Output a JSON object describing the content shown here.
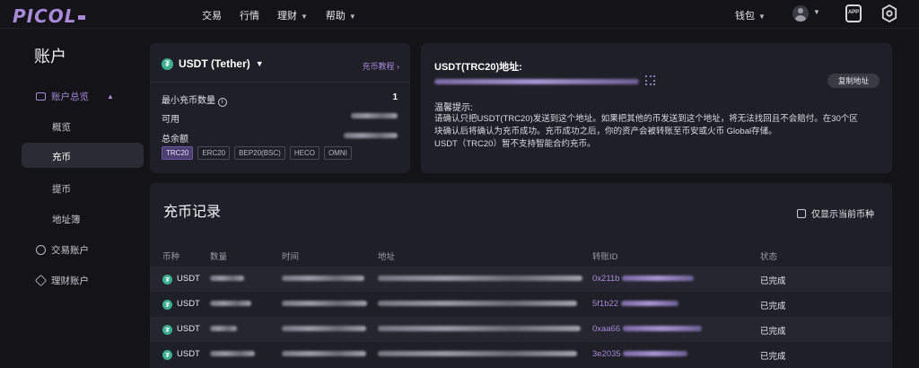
{
  "brand": {
    "logo": "PICOL"
  },
  "nav": {
    "items": [
      "交易",
      "行情",
      "理财",
      "帮助"
    ]
  },
  "topbar": {
    "wallet": "钱包",
    "app_icon": "APP"
  },
  "sidebar": {
    "title": "账户",
    "overview_group": "账户总览",
    "sub_items": [
      "概览",
      "充币",
      "提币",
      "地址簿"
    ],
    "trade_account": "交易账户",
    "finance_account": "理财账户"
  },
  "deposit": {
    "coin": "USDT (Tether)",
    "tutorial": "充币教程",
    "min_label": "最小充币数量",
    "min_value": "1",
    "available_label": "可用",
    "total_label": "总余额",
    "networks": [
      "TRC20",
      "ERC20",
      "BEP20(BSC)",
      "HECO",
      "OMNI"
    ],
    "active_network": "TRC20"
  },
  "address": {
    "title": "USDT(TRC20)地址:",
    "copy": "复制地址",
    "notice_title": "温馨提示:",
    "notice_lines": [
      "请确认只把USDT(TRC20)发送到这个地址。如果把其他的币发送到这个地址，将无法找回且不会赔付。在30个区",
      "块确认后将确认为充币成功。充币成功之后，你的资产会被转账至币安或火币 Global存储。",
      "USDT（TRC20）暂不支持智能合约充币。"
    ]
  },
  "records": {
    "title": "充币记录",
    "only_current": "仅显示当前币种",
    "headers": [
      "币种",
      "数量",
      "时间",
      "地址",
      "转账ID",
      "状态"
    ],
    "rows": [
      {
        "coin": "USDT",
        "txid": "0x211b",
        "status": "已完成"
      },
      {
        "coin": "USDT",
        "txid": "5f1b22",
        "status": "已完成"
      },
      {
        "coin": "USDT",
        "txid": "0xaa66",
        "status": "已完成"
      },
      {
        "coin": "USDT",
        "txid": "3e2035",
        "status": "已完成"
      }
    ]
  },
  "colors": {
    "accent": "#a98ad9",
    "background": "#131318",
    "panel": "#1f1f27",
    "tether": "#3bb08f"
  }
}
